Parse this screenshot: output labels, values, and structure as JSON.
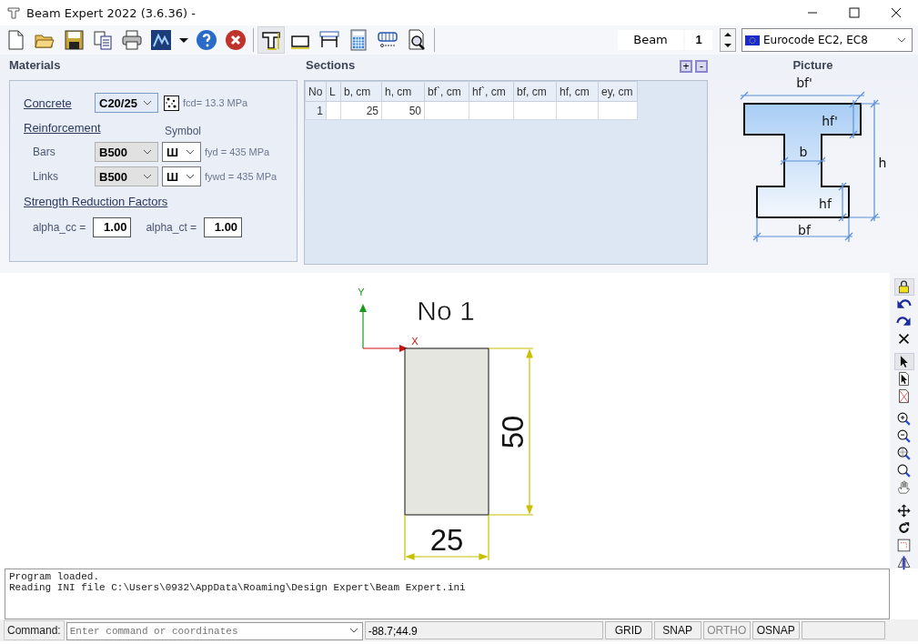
{
  "window": {
    "title": "Beam Expert 2022 (3.6.36) -"
  },
  "toolbar": {
    "groups": [
      {
        "items": [
          {
            "kind": "new",
            "pressed": false
          },
          {
            "kind": "open",
            "pressed": false
          },
          {
            "kind": "save",
            "pressed": false
          },
          {
            "kind": "copy",
            "pressed": false
          },
          {
            "kind": "print",
            "pressed": false
          },
          {
            "kind": "chart",
            "pressed": false
          },
          {
            "kind": "dropdown",
            "pressed": false
          },
          {
            "kind": "help",
            "pressed": false
          },
          {
            "kind": "stop",
            "pressed": false
          }
        ]
      },
      {
        "items": [
          {
            "kind": "t-section",
            "pressed": true
          },
          {
            "kind": "rect-section",
            "pressed": false
          },
          {
            "kind": "beam-frame",
            "pressed": false
          },
          {
            "kind": "calculator",
            "pressed": false
          },
          {
            "kind": "rebar",
            "pressed": false
          },
          {
            "kind": "preview",
            "pressed": false
          }
        ]
      }
    ]
  },
  "element": {
    "type": "Beam",
    "number": "1"
  },
  "code": {
    "value": "Eurocode EC2, EC8"
  },
  "materials": {
    "title": "Materials",
    "concrete": {
      "label": "Concrete",
      "grade": "C20/25",
      "info": "fcd= 13.3 MPa"
    },
    "reinforcement": {
      "label": "Reinforcement",
      "symbol_header": "Symbol",
      "rows": [
        {
          "label": "Bars",
          "grade": "B500",
          "symbol": "Ш",
          "info": "fyd = 435 MPa"
        },
        {
          "label": "Links",
          "grade": "B500",
          "symbol": "Ш",
          "info": "fywd = 435 MPa"
        }
      ]
    },
    "factors": {
      "label": "Strength Reduction Factors",
      "fields": [
        {
          "label": "alpha_cc =",
          "value": "1.00"
        },
        {
          "label": "alpha_ct =",
          "value": "1.00"
        }
      ]
    }
  },
  "sections": {
    "title": "Sections",
    "add": "+",
    "remove": "-",
    "columns": [
      "No",
      "L",
      "b, cm",
      "h, cm",
      "bf`, cm",
      "hf`, cm",
      "bf, cm",
      "hf, cm",
      "ey, cm"
    ],
    "rows": [
      [
        "1",
        "",
        "25",
        "50",
        "",
        "",
        "",
        "",
        ""
      ]
    ]
  },
  "picture": {
    "title": "Picture",
    "labels": {
      "bf_top": "bf'",
      "hf_top": "hf'",
      "b": "b",
      "h": "h",
      "hf": "hf",
      "bf": "bf"
    }
  },
  "canvas": {
    "section_title": "No 1",
    "axis_y": "Y",
    "axis_x": "X",
    "height_dim": "50",
    "width_dim": "25"
  },
  "side_toolbar": {
    "groups": [
      {
        "items": [
          {
            "kind": "lock",
            "pressed": true
          },
          {
            "kind": "undo",
            "pressed": false
          },
          {
            "kind": "redo",
            "pressed": false
          },
          {
            "kind": "delete",
            "pressed": false
          }
        ]
      },
      {
        "items": [
          {
            "kind": "select",
            "pressed": true
          },
          {
            "kind": "select-object",
            "pressed": false
          },
          {
            "kind": "erase-object",
            "pressed": false
          }
        ]
      },
      {
        "items": [
          {
            "kind": "zoom-in",
            "pressed": false
          },
          {
            "kind": "zoom-out",
            "pressed": false
          },
          {
            "kind": "zoom-window",
            "pressed": false
          },
          {
            "kind": "zoom-all",
            "pressed": false
          },
          {
            "kind": "pan",
            "pressed": false
          }
        ]
      },
      {
        "items": [
          {
            "kind": "move",
            "pressed": false
          },
          {
            "kind": "rotate",
            "pressed": false
          },
          {
            "kind": "region",
            "pressed": false
          },
          {
            "kind": "mirror",
            "pressed": false
          }
        ]
      }
    ]
  },
  "log": {
    "lines": [
      "Program loaded.",
      "Reading INI file C:\\Users\\0932\\AppData\\Roaming\\Design Expert\\Beam Expert.ini"
    ]
  },
  "status_bar": {
    "command_label": "Command:",
    "placeholder": "Enter command or coordinates",
    "coordinates": "-88.7;44.9",
    "toggles": [
      {
        "label": "GRID",
        "disabled": false
      },
      {
        "label": "SNAP",
        "disabled": false
      },
      {
        "label": "ORTHO",
        "disabled": true
      },
      {
        "label": "OSNAP",
        "disabled": false
      }
    ]
  }
}
